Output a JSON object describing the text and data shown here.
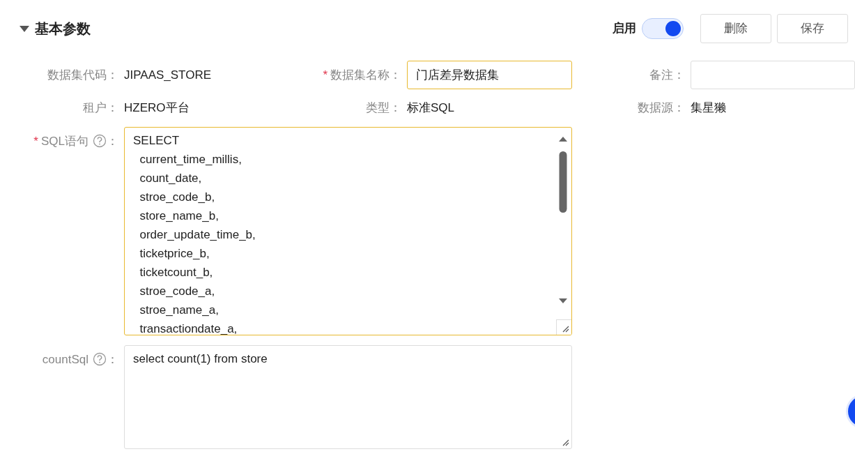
{
  "section": {
    "title": "基本参数",
    "expanded": true
  },
  "enable": {
    "label": "启用",
    "on": true
  },
  "buttons": [
    "删除",
    "保存"
  ],
  "fields": [
    {
      "label": "数据集代码：",
      "kind": "text",
      "value": "JIPAAS_STORE"
    },
    {
      "label": "数据集名称：",
      "kind": "input",
      "value": "门店差异数据集",
      "marker": "*",
      "highlighted": true
    },
    {
      "label": "备注：",
      "kind": "input",
      "highlighted": false
    },
    {
      "label": "租户：",
      "kind": "text",
      "value": "HZERO平台"
    },
    {
      "label": "类型：",
      "kind": "text",
      "value": "标准SQL"
    },
    {
      "label": "数据源：",
      "kind": "text",
      "value": "集星獭"
    }
  ],
  "editors": [
    {
      "label": "SQL语句",
      "marker": "*",
      "colon": "：",
      "help": true,
      "highlighted": true,
      "scrollbar": true,
      "lines": [
        "SELECT",
        "  current_time_millis,",
        "  count_date,",
        "  stroe_code_b,",
        "  store_name_b,",
        "  order_update_time_b,",
        "  ticketprice_b,",
        "  ticketcount_b,",
        "  stroe_code_a,",
        "  stroe_name_a,",
        "  transactiondate_a,"
      ]
    },
    {
      "label": "countSql",
      "colon": "：",
      "help": true,
      "highlighted": false,
      "scrollbar": false,
      "lines": [
        "select count(1) from store"
      ]
    }
  ]
}
